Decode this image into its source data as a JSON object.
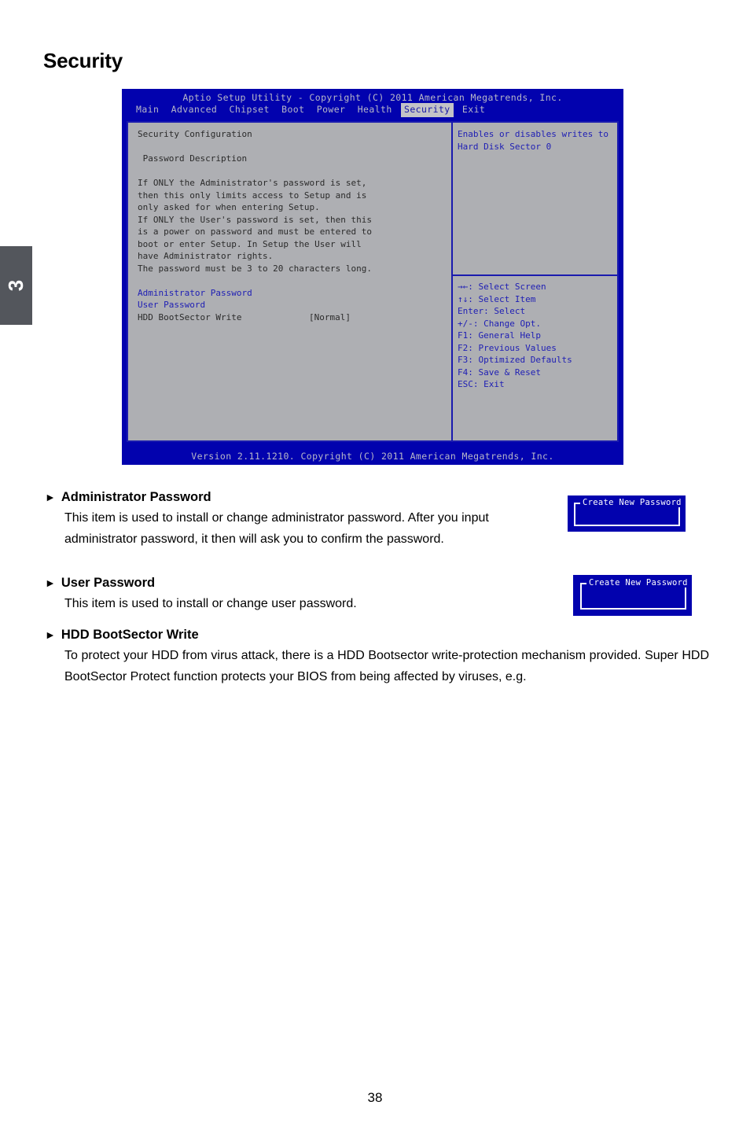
{
  "page": {
    "title": "Security",
    "chapter_tab": "3",
    "page_number": "38"
  },
  "bios": {
    "title_bar": "Aptio Setup Utility - Copyright (C) 2011 American Megatrends, Inc.",
    "menu_tabs": [
      {
        "label": "Main",
        "active": false
      },
      {
        "label": "Advanced",
        "active": false
      },
      {
        "label": "Chipset",
        "active": false
      },
      {
        "label": "Boot",
        "active": false
      },
      {
        "label": "Power",
        "active": false
      },
      {
        "label": "Health",
        "active": false
      },
      {
        "label": "Security",
        "active": true
      },
      {
        "label": "Exit",
        "active": false
      }
    ],
    "left_panel": {
      "heading": "Security Configuration",
      "subheading": " Password Description",
      "description_lines": [
        "If ONLY the Administrator's password is set,",
        "then this only limits access to Setup and is",
        "only asked for when entering Setup.",
        "If ONLY the User's password is set, then this",
        "is a power on password and must be entered to",
        "boot or enter Setup. In Setup the User will",
        "have Administrator rights.",
        "The password must be 3 to 20 characters long."
      ],
      "items": [
        {
          "name": "Administrator Password",
          "value": "",
          "link": true
        },
        {
          "name": "User Password",
          "value": "",
          "link": true
        },
        {
          "name": "HDD BootSector Write",
          "value": "[Normal]",
          "link": false
        }
      ]
    },
    "help_panel": {
      "description_lines": [
        "Enables or disables writes to",
        "Hard Disk Sector 0"
      ],
      "keys": [
        "→←: Select Screen",
        "↑↓: Select Item",
        "Enter: Select",
        "+/-: Change Opt.",
        "F1: General Help",
        "F2: Previous Values",
        "F3: Optimized Defaults",
        "F4: Save & Reset",
        "ESC: Exit"
      ]
    },
    "version_bar": "Version 2.11.1210. Copyright (C) 2011 American Megatrends, Inc."
  },
  "dialogs": {
    "admin_password": {
      "title": "Create New Password"
    },
    "user_password": {
      "title": "Create New Password"
    }
  },
  "sections": [
    {
      "bullet": "►",
      "heading": "Administrator Password",
      "body": "This item is used to install or change administrator password. After you input administrator password, it then will ask you to confirm the password."
    },
    {
      "bullet": "►",
      "heading": "User Password",
      "body": "This item is used to install or change user password."
    },
    {
      "bullet": "►",
      "heading": "HDD BootSector Write",
      "body": "To protect your HDD from virus attack, there is a HDD Bootsector write-protection mechanism provided. Super HDD BootSector Protect function protects your BIOS from being affected by viruses, e.g."
    }
  ],
  "colors": {
    "bios_background": "#0202ae",
    "bios_panel": "#aeafb3",
    "bios_panel_border": "#1a1aae",
    "bios_text_blue": "#1e1eb4",
    "bios_text_dark": "#2b2b2b",
    "bios_bar_text": "#b8b8c8",
    "chapter_tab": "#53565c",
    "dialog_background": "#0202ae",
    "dialog_border": "#ffffff"
  }
}
